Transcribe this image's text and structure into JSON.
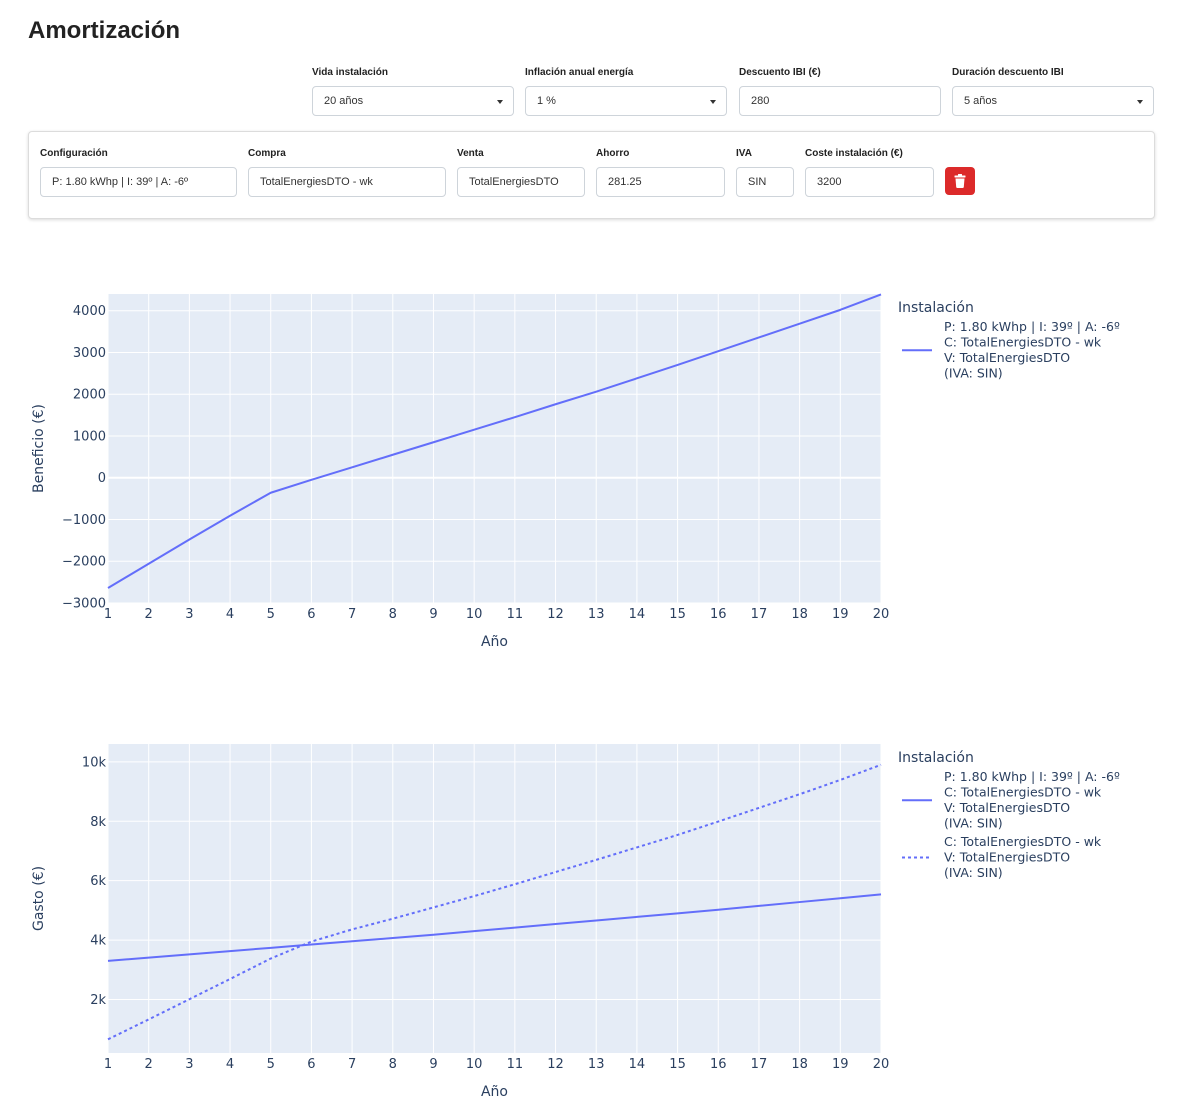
{
  "page": {
    "title": "Amortización"
  },
  "filters": {
    "vida": {
      "label": "Vida instalación",
      "value": "20 años"
    },
    "inflacion": {
      "label": "Inflación anual energía",
      "value": "1 %"
    },
    "ibi": {
      "label": "Descuento IBI (€)",
      "value": "280"
    },
    "duracion": {
      "label": "Duración descuento IBI",
      "value": "5 años"
    }
  },
  "config_row": {
    "configuracion": {
      "label": "Configuración",
      "value": "P: 1.80 kWhp | I: 39º | A:  -6º"
    },
    "compra": {
      "label": "Compra",
      "value": "TotalEnergiesDTO - wk"
    },
    "venta": {
      "label": "Venta",
      "value": "TotalEnergiesDTO"
    },
    "ahorro": {
      "label": "Ahorro",
      "value": "281.25"
    },
    "iva": {
      "label": "IVA",
      "value": "SIN"
    },
    "coste": {
      "label": "Coste instalación (€)",
      "value": "3200"
    },
    "delete_icon": "trash-icon",
    "delete_color": "#dc2a2a"
  },
  "chart_data": [
    {
      "type": "line",
      "xlabel": "Año",
      "ylabel": "Beneficio (€)",
      "xlim": [
        1,
        20
      ],
      "ylim": [
        -3000,
        4400
      ],
      "x_ticks": [
        1,
        2,
        3,
        4,
        5,
        6,
        7,
        8,
        9,
        10,
        11,
        12,
        13,
        14,
        15,
        16,
        17,
        18,
        19,
        20
      ],
      "y_ticks": [
        -3000,
        -2000,
        -1000,
        0,
        1000,
        2000,
        3000,
        4000
      ],
      "y_tick_labels": [
        "−3000",
        "−2000",
        "−1000",
        "0",
        "1000",
        "2000",
        "3000",
        "4000"
      ],
      "grid": true,
      "legend": {
        "title": "Instalación",
        "position": "right",
        "entries": [
          {
            "lines": [
              "P: 1.80 kWhp | I: 39º | A:  -6º",
              "C: TotalEnergiesDTO - wk",
              "V: TotalEnergiesDTO",
              "(IVA: SIN)"
            ],
            "dash": "solid"
          }
        ]
      },
      "series": [
        {
          "color": "#636efa",
          "dash": "solid",
          "x": [
            1,
            2,
            3,
            4,
            5,
            6,
            7,
            8,
            9,
            10,
            11,
            12,
            13,
            14,
            15,
            16,
            17,
            18,
            19,
            20
          ],
          "y": [
            -2640,
            -2060,
            -1480,
            -910,
            -360,
            -50,
            250,
            550,
            850,
            1150,
            1450,
            1760,
            2060,
            2380,
            2700,
            3030,
            3360,
            3690,
            4020,
            4390
          ]
        }
      ]
    },
    {
      "type": "line",
      "xlabel": "Año",
      "ylabel": "Gasto (€)",
      "xlim": [
        1,
        20
      ],
      "ylim": [
        200,
        10600
      ],
      "x_ticks": [
        1,
        2,
        3,
        4,
        5,
        6,
        7,
        8,
        9,
        10,
        11,
        12,
        13,
        14,
        15,
        16,
        17,
        18,
        19,
        20
      ],
      "y_ticks": [
        2000,
        4000,
        6000,
        8000,
        10000
      ],
      "y_tick_labels": [
        "2k",
        "4k",
        "6k",
        "8k",
        "10k"
      ],
      "grid": true,
      "legend": {
        "title": "Instalación",
        "position": "right",
        "entries": [
          {
            "lines": [
              "P: 1.80 kWhp | I: 39º | A:  -6º",
              "C: TotalEnergiesDTO - wk",
              "V: TotalEnergiesDTO",
              "(IVA: SIN)"
            ],
            "dash": "solid"
          },
          {
            "lines": [
              "C: TotalEnergiesDTO - wk",
              "V: TotalEnergiesDTO",
              "(IVA: SIN)"
            ],
            "dash": "dot"
          }
        ]
      },
      "series": [
        {
          "color": "#636efa",
          "dash": "solid",
          "x": [
            1,
            2,
            3,
            4,
            5,
            6,
            7,
            8,
            9,
            10,
            11,
            12,
            13,
            14,
            15,
            16,
            17,
            18,
            19,
            20
          ],
          "y": [
            3300,
            3410,
            3520,
            3630,
            3740,
            3850,
            3960,
            4070,
            4180,
            4300,
            4420,
            4540,
            4660,
            4780,
            4900,
            5020,
            5150,
            5280,
            5410,
            5540
          ]
        },
        {
          "color": "#636efa",
          "dash": "dot",
          "x": [
            1,
            2,
            3,
            4,
            5,
            6,
            7,
            8,
            9,
            10,
            11,
            12,
            13,
            14,
            15,
            16,
            17,
            18,
            19,
            20
          ],
          "y": [
            660,
            1330,
            2010,
            2690,
            3380,
            3950,
            4360,
            4720,
            5100,
            5480,
            5880,
            6290,
            6700,
            7120,
            7540,
            7990,
            8450,
            8910,
            9390,
            9900
          ]
        }
      ]
    }
  ]
}
